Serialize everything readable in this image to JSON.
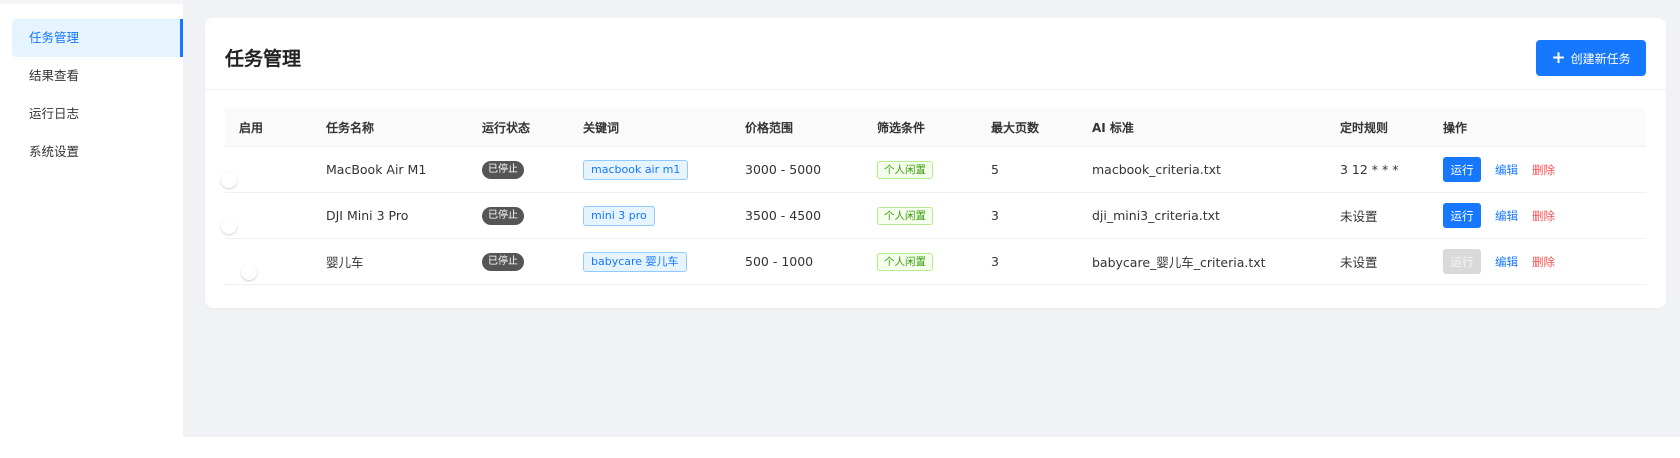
{
  "sidebar": {
    "items": [
      {
        "label": "任务管理"
      },
      {
        "label": "结果查看"
      },
      {
        "label": "运行日志"
      },
      {
        "label": "系统设置"
      }
    ]
  },
  "header": {
    "title": "任务管理",
    "create_button_label": "创建新任务",
    "create_icon": "plus-icon"
  },
  "table": {
    "columns": [
      "启用",
      "任务名称",
      "运行状态",
      "关键词",
      "价格范围",
      "筛选条件",
      "最大页数",
      "AI 标准",
      "定时规则",
      "操作"
    ],
    "rows": [
      {
        "enabled": true,
        "name": "MacBook Air M1",
        "status": "已停止",
        "keyword": "macbook air m1",
        "price": "3000 - 5000",
        "filter": "个人闲置",
        "max_pages": "5",
        "ai_criteria": "macbook_criteria.txt",
        "schedule": "3 12 * * *",
        "run": "运行",
        "edit": "编辑",
        "delete": "删除",
        "run_enabled": true
      },
      {
        "enabled": true,
        "name": "DJI Mini 3 Pro",
        "status": "已停止",
        "keyword": "mini 3 pro",
        "price": "3500 - 4500",
        "filter": "个人闲置",
        "max_pages": "3",
        "ai_criteria": "dji_mini3_criteria.txt",
        "schedule": "未设置",
        "run": "运行",
        "edit": "编辑",
        "delete": "删除",
        "run_enabled": true
      },
      {
        "enabled": false,
        "name": "婴儿车",
        "status": "已停止",
        "keyword": "babycare 婴儿车",
        "price": "500 - 1000",
        "filter": "个人闲置",
        "max_pages": "3",
        "ai_criteria": "babycare_婴儿车_criteria.txt",
        "schedule": "未设置",
        "run": "运行",
        "edit": "编辑",
        "delete": "删除",
        "run_enabled": false
      }
    ]
  },
  "colors": {
    "accent": "#1677ff",
    "toggle_on": "#52c41a",
    "danger": "#ff4d4f"
  }
}
